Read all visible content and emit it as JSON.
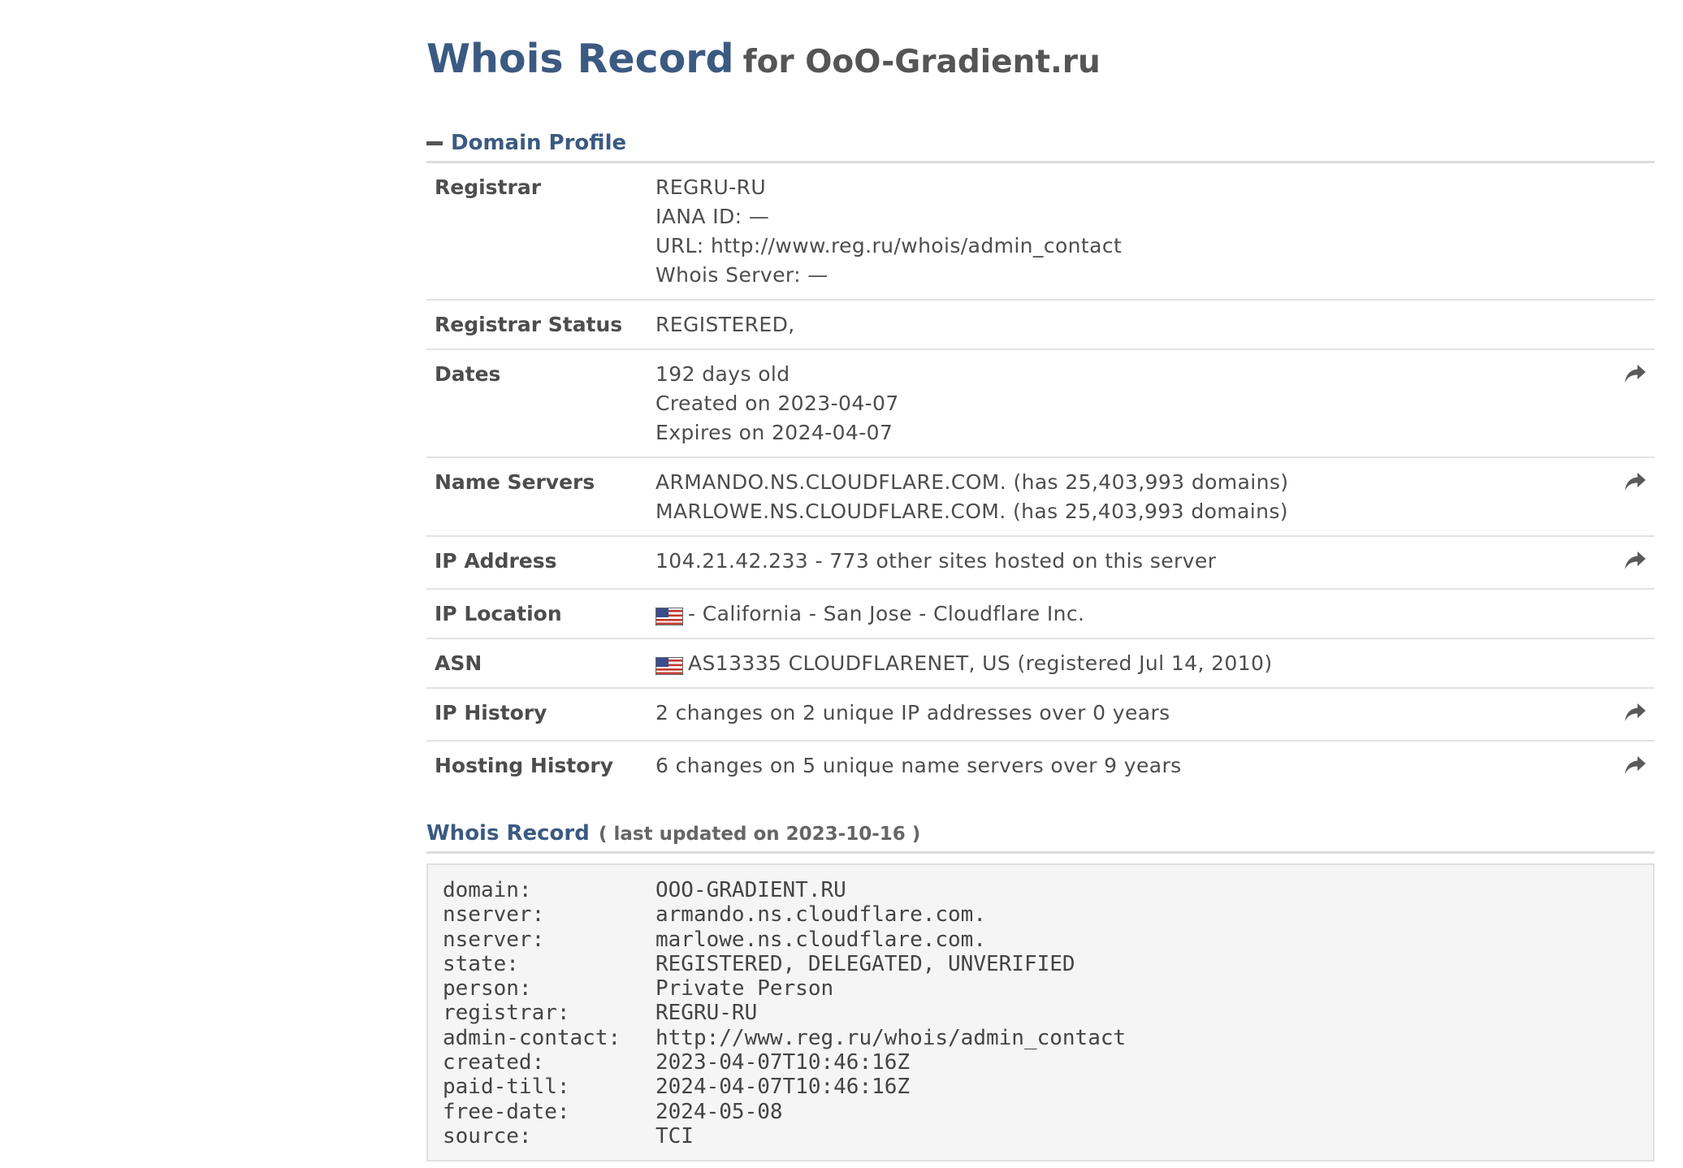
{
  "header": {
    "title": "Whois Record",
    "subtitle": "for OoO-Gradient.ru"
  },
  "profile": {
    "section_title": "Domain Profile",
    "rows": [
      {
        "label": "Registrar",
        "lines": [
          "REGRU-RU",
          "IANA ID: —",
          "URL: http://www.reg.ru/whois/admin_contact",
          "Whois Server: —"
        ],
        "action": false
      },
      {
        "label": "Registrar Status",
        "lines": [
          "REGISTERED,"
        ],
        "action": false
      },
      {
        "label": "Dates",
        "lines": [
          "192 days old",
          "Created on 2023-04-07",
          "Expires on 2024-04-07"
        ],
        "action": true
      },
      {
        "label": "Name Servers",
        "lines": [
          "ARMANDO.NS.CLOUDFLARE.COM. (has 25,403,993 domains)",
          "MARLOWE.NS.CLOUDFLARE.COM. (has 25,403,993 domains)"
        ],
        "action": true
      },
      {
        "label": "IP Address",
        "lines": [
          "104.21.42.233 - 773 other sites hosted on this server"
        ],
        "action": true
      },
      {
        "label": "IP Location",
        "lines": [
          "- California - San Jose - Cloudflare Inc."
        ],
        "action": false,
        "flag": "us-flag-icon"
      },
      {
        "label": "ASN",
        "lines": [
          "AS13335 CLOUDFLARENET, US (registered Jul 14, 2010)"
        ],
        "action": false,
        "flag": "us-flag-icon"
      },
      {
        "label": "IP History",
        "lines": [
          "2 changes on 2 unique IP addresses over 0 years"
        ],
        "action": true
      },
      {
        "label": "Hosting History",
        "lines": [
          "6 changes on 5 unique name servers over 9 years"
        ],
        "action": true
      }
    ]
  },
  "whois": {
    "title": "Whois Record",
    "updated": "( last updated on 2023-10-16 )",
    "lines": [
      {
        "key": "domain:",
        "value": "OOO-GRADIENT.RU"
      },
      {
        "key": "nserver:",
        "value": "armando.ns.cloudflare.com."
      },
      {
        "key": "nserver:",
        "value": "marlowe.ns.cloudflare.com."
      },
      {
        "key": "state:",
        "value": "REGISTERED, DELEGATED, UNVERIFIED"
      },
      {
        "key": "person:",
        "value": "Private Person"
      },
      {
        "key": "registrar:",
        "value": "REGRU-RU"
      },
      {
        "key": "admin-contact:",
        "value": "http://www.reg.ru/whois/admin_contact"
      },
      {
        "key": "created:",
        "value": "2023-04-07T10:46:16Z"
      },
      {
        "key": "paid-till:",
        "value": "2024-04-07T10:46:16Z"
      },
      {
        "key": "free-date:",
        "value": "2024-05-08"
      },
      {
        "key": "source:",
        "value": "TCI"
      }
    ]
  },
  "colors": {
    "accent": "#3b5a82",
    "text": "#4d4d4d",
    "divider": "#e2e2e2",
    "raw_background": "#f5f5f5"
  },
  "icons": {
    "collapse": "minus-icon",
    "action": "share-arrow-icon",
    "flag": "us-flag-icon"
  }
}
